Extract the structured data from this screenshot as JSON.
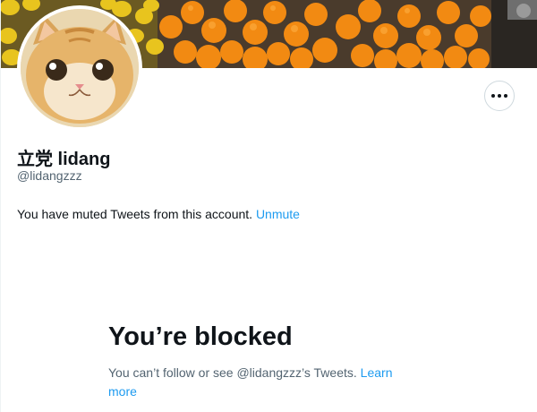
{
  "profile": {
    "display_name": "立党 lidang",
    "handle": "@lidangzzz",
    "more_icon": "more-horizontal-icon",
    "banner_image": "oranges-banner",
    "avatar_image": "cat-avatar"
  },
  "muted_notice": {
    "text": "You have muted Tweets from this account.",
    "action_label": "Unmute"
  },
  "blocked": {
    "title": "You’re blocked",
    "description": "You can’t follow or see @lidangzzz’s Tweets.",
    "learn_more": "Learn more"
  },
  "colors": {
    "accent": "#1d9bf0",
    "secondary_text": "#536471",
    "primary_text": "#0f1419"
  }
}
